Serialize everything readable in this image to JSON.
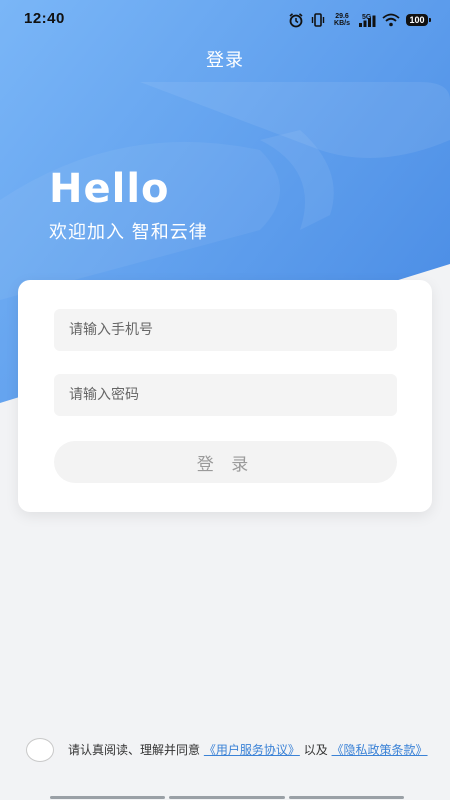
{
  "status_bar": {
    "time": "12:40",
    "net_speed_value": "29.6",
    "net_speed_unit": "KB/s",
    "network_label": "5G",
    "battery": "100"
  },
  "nav": {
    "title": "登录"
  },
  "hero": {
    "greeting": "Hello",
    "welcome": "欢迎加入 智和云律"
  },
  "form": {
    "phone_placeholder": "请输入手机号",
    "password_placeholder": "请输入密码",
    "login_label": "登 录"
  },
  "agreement": {
    "prefix": "请认真阅读、理解并同意",
    "service_link": "《用户服务协议》",
    "connector": "以及",
    "privacy_link": "《隐私政策条款》"
  },
  "colors": {
    "hero_blue": "#5b9ff0",
    "card_bg": "#ffffff",
    "link_blue": "#3b82d6",
    "page_bg": "#f2f3f5"
  }
}
